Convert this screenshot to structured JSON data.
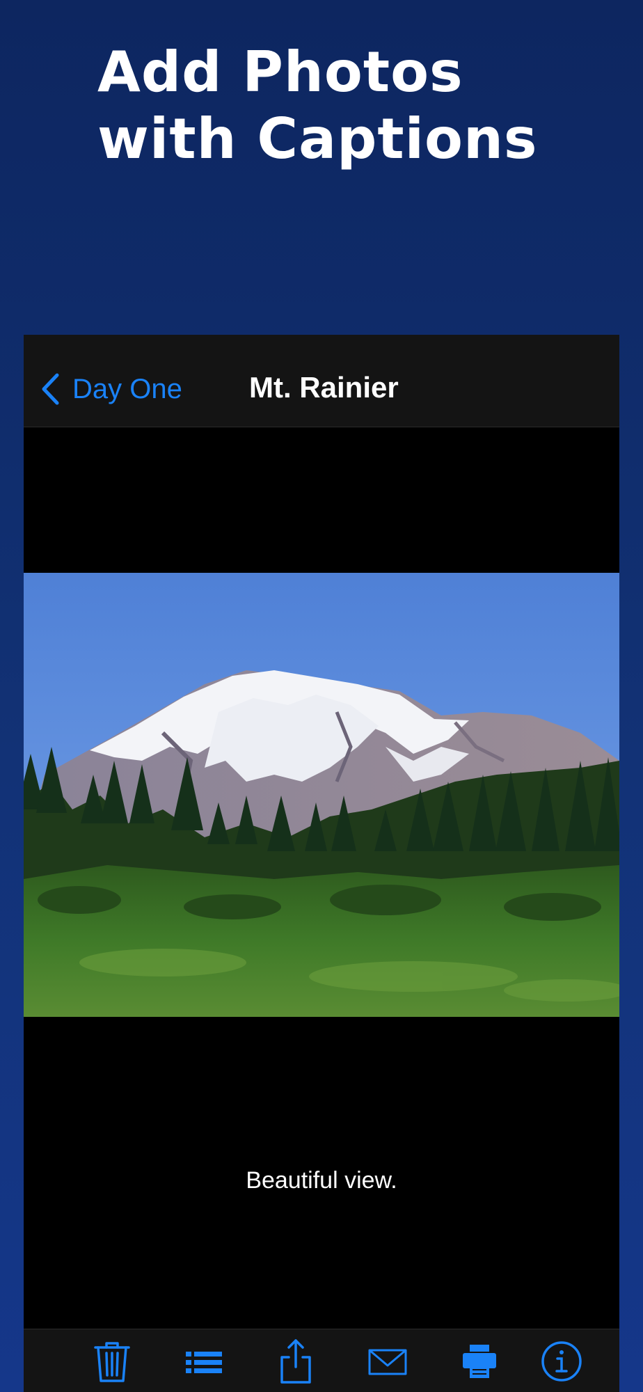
{
  "headline": {
    "line1": "Add Photos",
    "line2": "with Captions"
  },
  "navbar": {
    "back_label": "Day One",
    "title": "Mt. Rainier"
  },
  "photo": {
    "caption": "Beautiful view."
  },
  "toolbar": {
    "icons": [
      "trash-icon",
      "list-icon",
      "share-icon",
      "mail-icon",
      "print-icon",
      "info-icon"
    ]
  },
  "colors": {
    "background": "#0d2660",
    "accent": "#1a82f7",
    "bar": "#141414"
  }
}
